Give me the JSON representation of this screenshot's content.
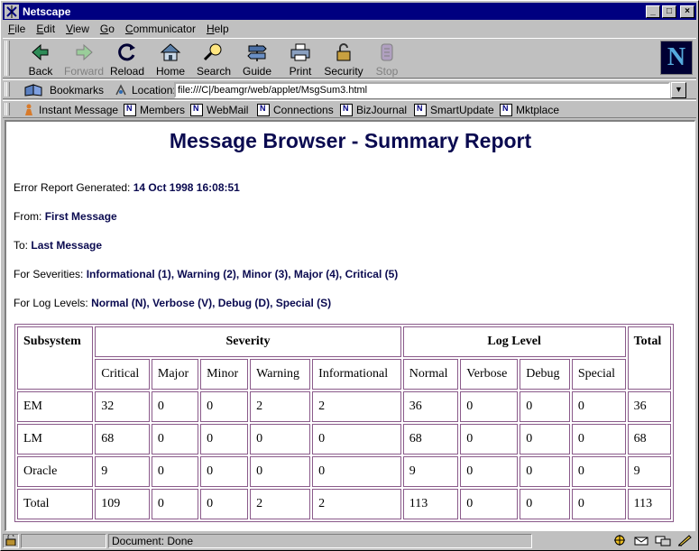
{
  "window": {
    "title": "Netscape"
  },
  "menu": [
    "File",
    "Edit",
    "View",
    "Go",
    "Communicator",
    "Help"
  ],
  "menu_underline": [
    "F",
    "E",
    "V",
    "G",
    "C",
    "H"
  ],
  "toolbar": {
    "back": "Back",
    "forward": "Forward",
    "reload": "Reload",
    "home": "Home",
    "search": "Search",
    "guide": "Guide",
    "print": "Print",
    "security": "Security",
    "stop": "Stop"
  },
  "location": {
    "bookmarks_label": "Bookmarks",
    "label": "Location:",
    "url": "file:///C|/beamgr/web/applet/MsgSum3.html"
  },
  "personal_toolbar": [
    "Instant Message",
    "Members",
    "WebMail",
    "Connections",
    "BizJournal",
    "SmartUpdate",
    "Mktplace"
  ],
  "page": {
    "heading": "Message Browser - Summary Report",
    "generated_label": "Error Report Generated:",
    "generated_value": "14 Oct 1998 16:08:51",
    "from_label": "From:",
    "from_value": "First Message",
    "to_label": "To:",
    "to_value": "Last Message",
    "severities_label": "For Severities:",
    "severities_value": "Informational (1), Warning (2), Minor (3), Major (4), Critical (5)",
    "loglevels_label": "For Log Levels:",
    "loglevels_value": "Normal (N), Verbose (V), Debug (D), Special (S)"
  },
  "table": {
    "subsystem_header": "Subsystem",
    "severity_header": "Severity",
    "loglevel_header": "Log Level",
    "total_header": "Total",
    "sub_headers": [
      "Critical",
      "Major",
      "Minor",
      "Warning",
      "Informational",
      "Normal",
      "Verbose",
      "Debug",
      "Special"
    ],
    "rows": [
      [
        "EM",
        "32",
        "0",
        "0",
        "2",
        "2",
        "36",
        "0",
        "0",
        "0",
        "36"
      ],
      [
        "LM",
        "68",
        "0",
        "0",
        "0",
        "0",
        "68",
        "0",
        "0",
        "0",
        "68"
      ],
      [
        "Oracle",
        "9",
        "0",
        "0",
        "0",
        "0",
        "9",
        "0",
        "0",
        "0",
        "9"
      ],
      [
        "Total",
        "109",
        "0",
        "0",
        "2",
        "2",
        "113",
        "0",
        "0",
        "0",
        "113"
      ]
    ]
  },
  "status": {
    "text": "Document: Done"
  },
  "colors": {
    "titlebar": "#000080",
    "heading": "#0a0a50",
    "table_border": "#8a5a8a"
  }
}
